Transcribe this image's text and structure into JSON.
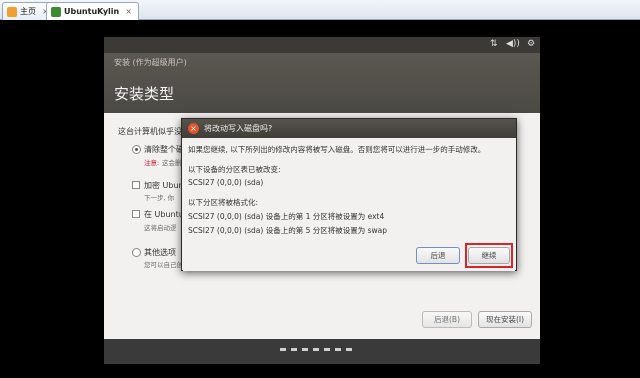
{
  "host_tabs": [
    {
      "label": "主页",
      "icon": "home-icon"
    },
    {
      "label": "UbuntuKylin",
      "icon": "ubuntu-kylin-icon"
    }
  ],
  "indicators": [
    "⇅",
    "◀))",
    "⚙"
  ],
  "installer": {
    "window_title": "安装 (作为超级用户)",
    "heading": "安装类型",
    "question": "这台计算机似乎没",
    "options": [
      {
        "label": "清除整个磁",
        "note_label": "注意:",
        "note": "这会删",
        "selected": true
      },
      {
        "label": "加密 Ubunt",
        "note": "下一步, 你"
      },
      {
        "label": "在 Ubuntu",
        "note": "这将启动逻"
      },
      {
        "label": "其他选项",
        "note": "您可以自己创"
      }
    ],
    "back_button": "后退(B)",
    "install_button": "现在安装(I)"
  },
  "dialog": {
    "title": "将改动写入磁盘吗?",
    "intro": "如果您继续, 以下所列出的修改内容将被写入磁盘。否则您将可以进行进一步的手动修改。",
    "partition_table_heading": "以下设备的分区表已被改变:",
    "partition_table_device": "SCSI27 (0,0,0) (sda)",
    "format_heading": "以下分区将被格式化:",
    "format_items": [
      "SCSI27 (0,0,0) (sda) 设备上的第 1 分区将被设置为 ext4",
      "SCSI27 (0,0,0) (sda) 设备上的第 5 分区将被设置为 swap"
    ],
    "back_button": "后退",
    "continue_button": "继续",
    "highlight_color": "#d9232d"
  },
  "progress_dots": 7
}
